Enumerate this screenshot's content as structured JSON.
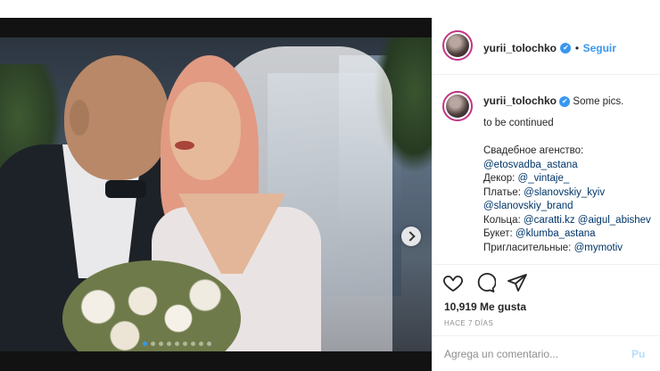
{
  "post": {
    "username": "yurii_tolochko",
    "verified_glyph": "✔",
    "follow_separator": "•",
    "follow_label": "Seguir",
    "caption": {
      "first": "Some pics.",
      "second": "to be continued",
      "lines": [
        {
          "label": "Свадебное агенство:",
          "tag": ""
        },
        {
          "label": "",
          "tag": "@etosvadba_astana"
        },
        {
          "label": "Декор: ",
          "tag": "@_vintaje_"
        },
        {
          "label": "Платье: ",
          "tag": "@slanovskiy_kyiv"
        },
        {
          "label": "",
          "tag": "@slanovskiy_brand"
        },
        {
          "label": "Кольца: ",
          "tag": "@caratti.kz @aigul_abishev"
        },
        {
          "label": "Букет: ",
          "tag": "@klumba_astana"
        },
        {
          "label": "Пригласительные: ",
          "tag": "@mymotiv"
        }
      ]
    },
    "likes": "10,919 Me gusta",
    "date": "HACE 7 DÍAS",
    "comment_placeholder": "Agrega un comentario...",
    "publish_label": "Pu"
  },
  "carousel": {
    "slides": 9,
    "active_index": 0
  },
  "icons": {
    "like": "heart-icon",
    "comment": "comment-icon",
    "share": "share-icon",
    "next": "chevron-right-icon",
    "verified": "verified-badge-icon"
  },
  "colors": {
    "accent": "#3897f0",
    "tag": "#003569",
    "muted": "#8e8e8e",
    "story_ring": "#c13584"
  }
}
